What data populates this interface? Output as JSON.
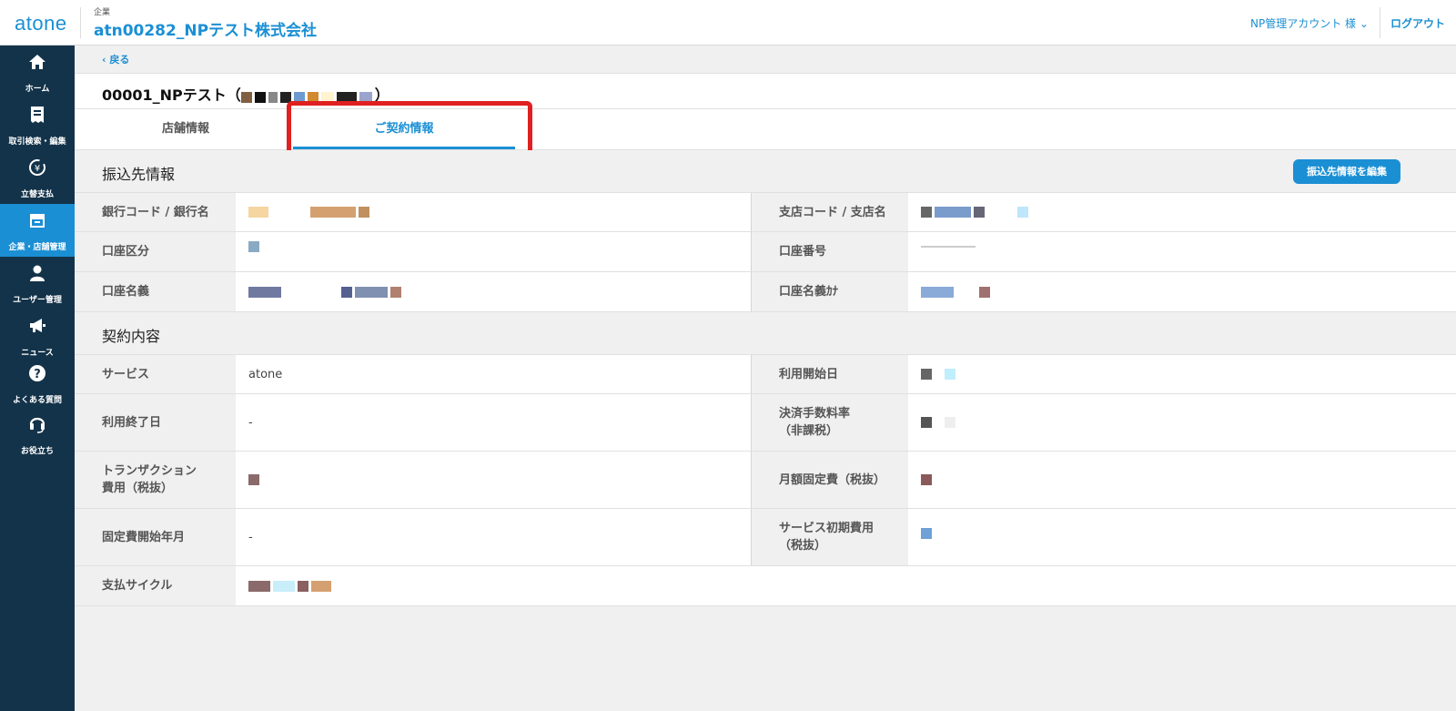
{
  "header": {
    "logo": "atone",
    "company_small_label": "企業",
    "company_name": "atn00282_NPテスト株式会社",
    "account": "NP管理アカウント 様",
    "logout": "ログアウト"
  },
  "sidebar": {
    "items": [
      {
        "label": "ホーム",
        "icon": "home-icon"
      },
      {
        "label": "取引検索・編集",
        "icon": "receipt-icon"
      },
      {
        "label": "立替支払",
        "icon": "yen-cycle-icon"
      },
      {
        "label": "企業・店舗管理",
        "icon": "store-icon",
        "active": true
      },
      {
        "label": "ユーザー管理",
        "icon": "user-icon"
      },
      {
        "label": "ニュース",
        "icon": "megaphone-icon"
      },
      {
        "label": "よくある質問",
        "icon": "question-icon"
      },
      {
        "label": "お役立ち",
        "icon": "headset-icon"
      }
    ]
  },
  "main": {
    "back": "戻る",
    "page_title": "00001_NPテスト（",
    "page_title_end": "）",
    "tabs": [
      {
        "label": "店舗情報",
        "active": false
      },
      {
        "label": "ご契約情報",
        "active": true
      }
    ],
    "bank_section": {
      "title": "振込先情報",
      "edit_button": "振込先情報を編集",
      "rows": [
        {
          "left_label": "銀行コード / 銀行名",
          "right_label": "支店コード / 支店名"
        },
        {
          "left_label": "口座区分",
          "right_label": "口座番号"
        },
        {
          "left_label": "口座名義",
          "right_label": "口座名義ｶﾅ"
        }
      ]
    },
    "contract_section": {
      "title": "契約内容",
      "service_label": "サービス",
      "service_value": "atone",
      "start_label": "利用開始日",
      "end_label": "利用終了日",
      "end_value": "-",
      "fee_rate_label_1": "決済手数料率",
      "fee_rate_label_2": "（非課税）",
      "txn_label_1": "トランザクション",
      "txn_label_2": "費用（税抜）",
      "monthly_label": "月額固定費（税抜）",
      "fixed_start_label": "固定費開始年月",
      "fixed_start_value": "-",
      "initial_label_1": "サービス初期費用",
      "initial_label_2": "（税抜）",
      "cycle_label": "支払サイクル"
    }
  },
  "colors": {
    "accent": "#1b8fd4",
    "sidebar_bg": "#13334a",
    "highlight": "#e02020"
  }
}
